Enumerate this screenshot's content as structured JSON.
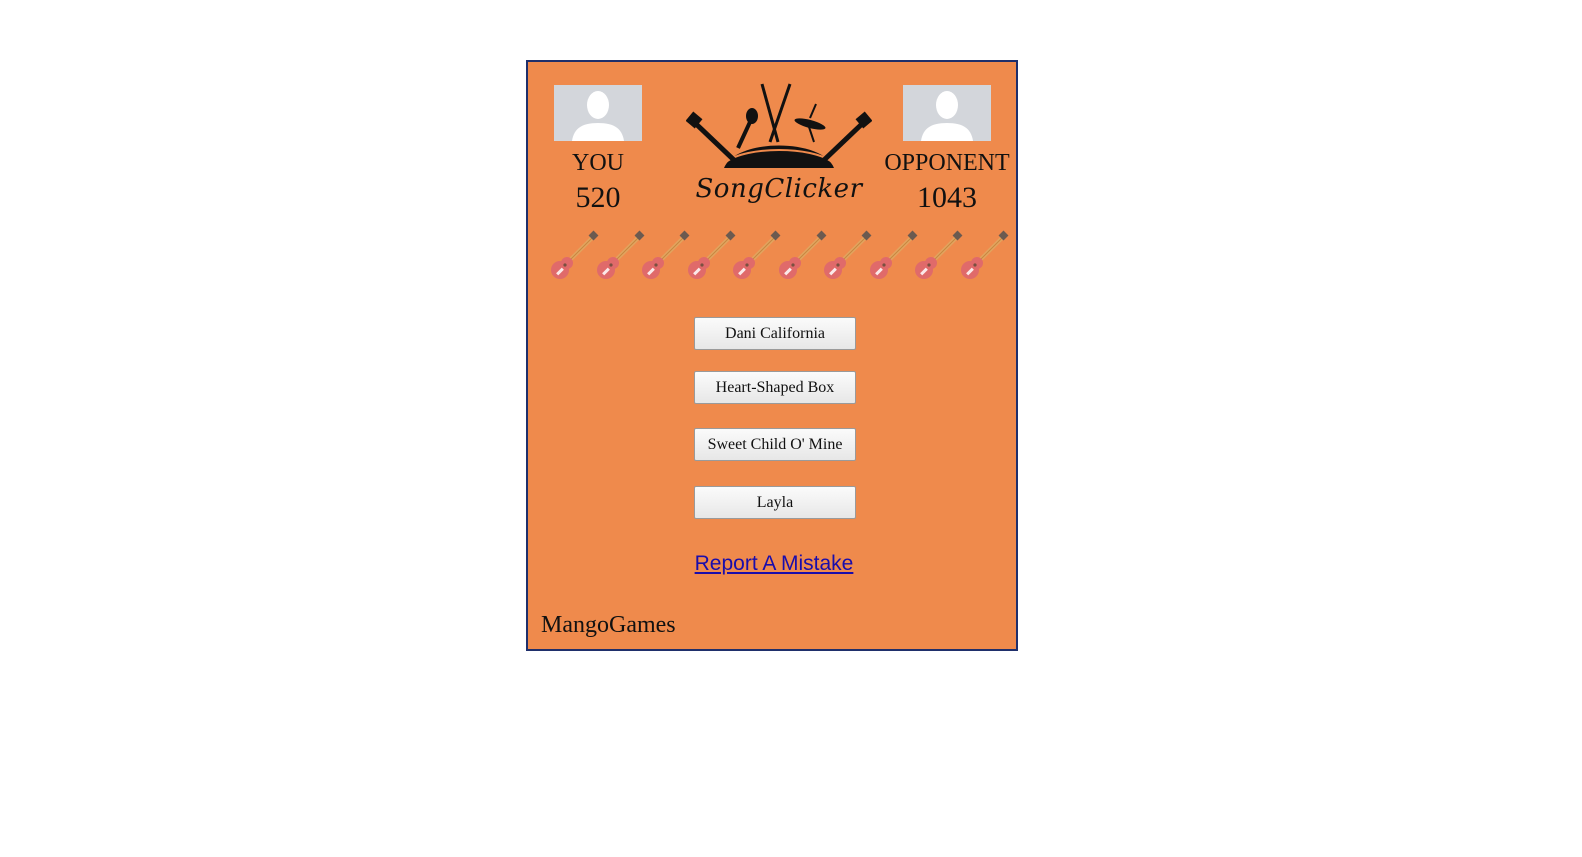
{
  "players": {
    "you": {
      "label": "YOU",
      "score": "520"
    },
    "opponent": {
      "label": "OPPONENT",
      "score": "1043"
    }
  },
  "logo": {
    "text": "SongClicker"
  },
  "lives": {
    "count": 10,
    "icon": "guitar-icon"
  },
  "answers": [
    {
      "label": "Dani California"
    },
    {
      "label": "Heart-Shaped Box"
    },
    {
      "label": "Sweet Child O' Mine"
    },
    {
      "label": "Layla"
    }
  ],
  "report": {
    "label": "Report A Mistake"
  },
  "footer": {
    "brand": "MangoGames"
  },
  "colors": {
    "background": "#ef8a4c",
    "border": "#1f2f6b",
    "link": "#1a0dab",
    "avatar": "#d3d6db"
  }
}
